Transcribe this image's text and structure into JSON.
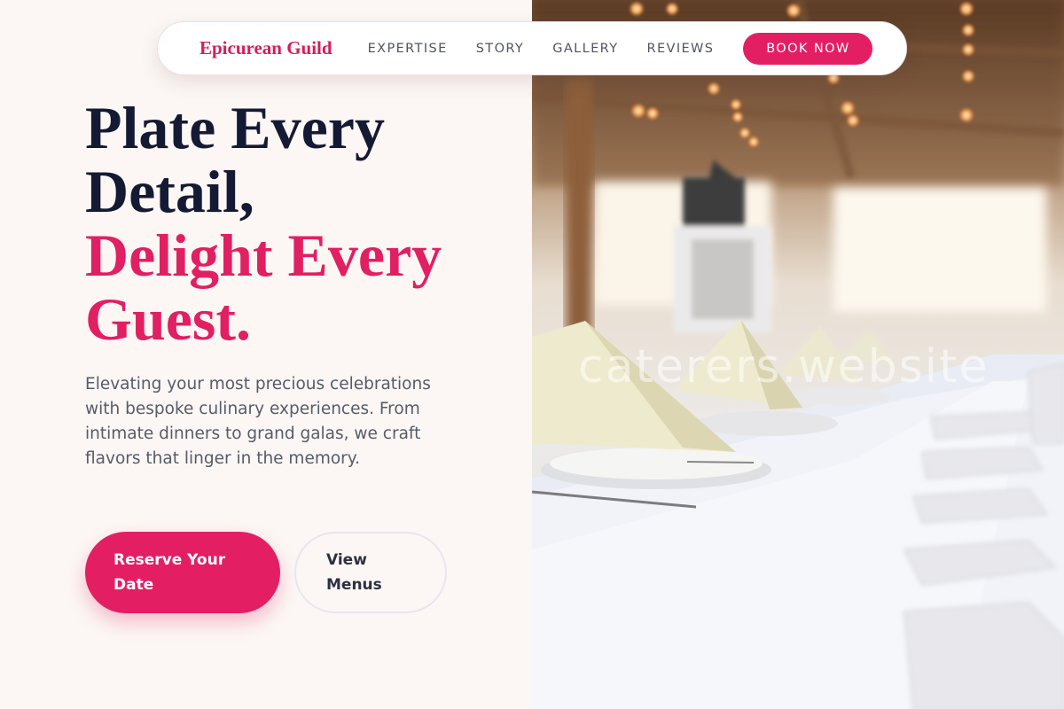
{
  "nav": {
    "brand": "Epicurean Guild",
    "links": [
      "EXPERTISE",
      "STORY",
      "GALLERY",
      "REVIEWS"
    ],
    "cta": "BOOK NOW"
  },
  "hero": {
    "title_line1": "Plate Every",
    "title_line2": "Detail,",
    "title_accent_line1": "Delight Every",
    "title_accent_line2": "Guest.",
    "description": "Elevating your most precious celebrations with bespoke culinary experiences. From intimate dinners to grand galas, we craft flavors that linger in the memory.",
    "primary_button": "Reserve Your Date",
    "secondary_button": "View Menus"
  },
  "photo": {
    "watermark": "caterers.website"
  },
  "colors": {
    "accent": "#e41e63",
    "heading": "#141a33",
    "background": "#fcf7f4",
    "body_text": "#565b6a"
  }
}
